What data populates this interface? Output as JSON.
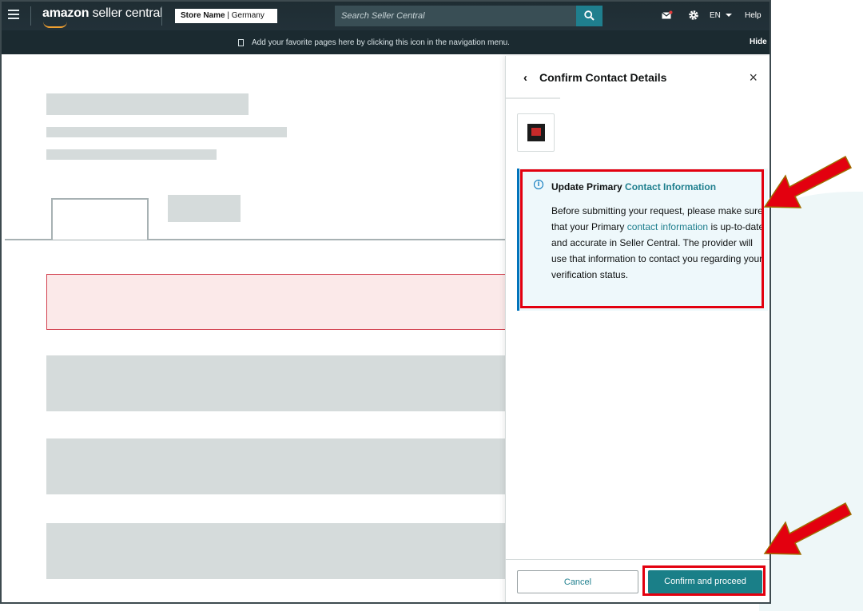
{
  "topnav": {
    "logo_main": "amazon",
    "logo_sub": "seller central",
    "store_name": "Store Name",
    "store_country": "Germany",
    "search_placeholder": "Search Seller Central",
    "language": "EN",
    "help": "Help"
  },
  "subnav": {
    "message": "Add your favorite pages here by clicking this icon in the navigation menu.",
    "hide": "Hide"
  },
  "panel": {
    "back": "‹",
    "title": "Confirm Contact Details",
    "close": "×",
    "info": {
      "title_prefix": "Update Primary",
      "title_link": "Contact Information",
      "body_1": "Before submitting your request, please make sure that your Primary",
      "body_link": "contact information",
      "body_2": "is up-to-date and accurate in Seller Central. The provider will use that information to contact you regarding your verification status."
    },
    "cancel": "Cancel",
    "confirm": "Confirm and proceed"
  },
  "colors": {
    "nav_bg": "#1f2d33",
    "accent": "#1a7f88",
    "link": "#1f7f8e",
    "info_border": "#0073bb",
    "highlight": "#e3000f"
  }
}
